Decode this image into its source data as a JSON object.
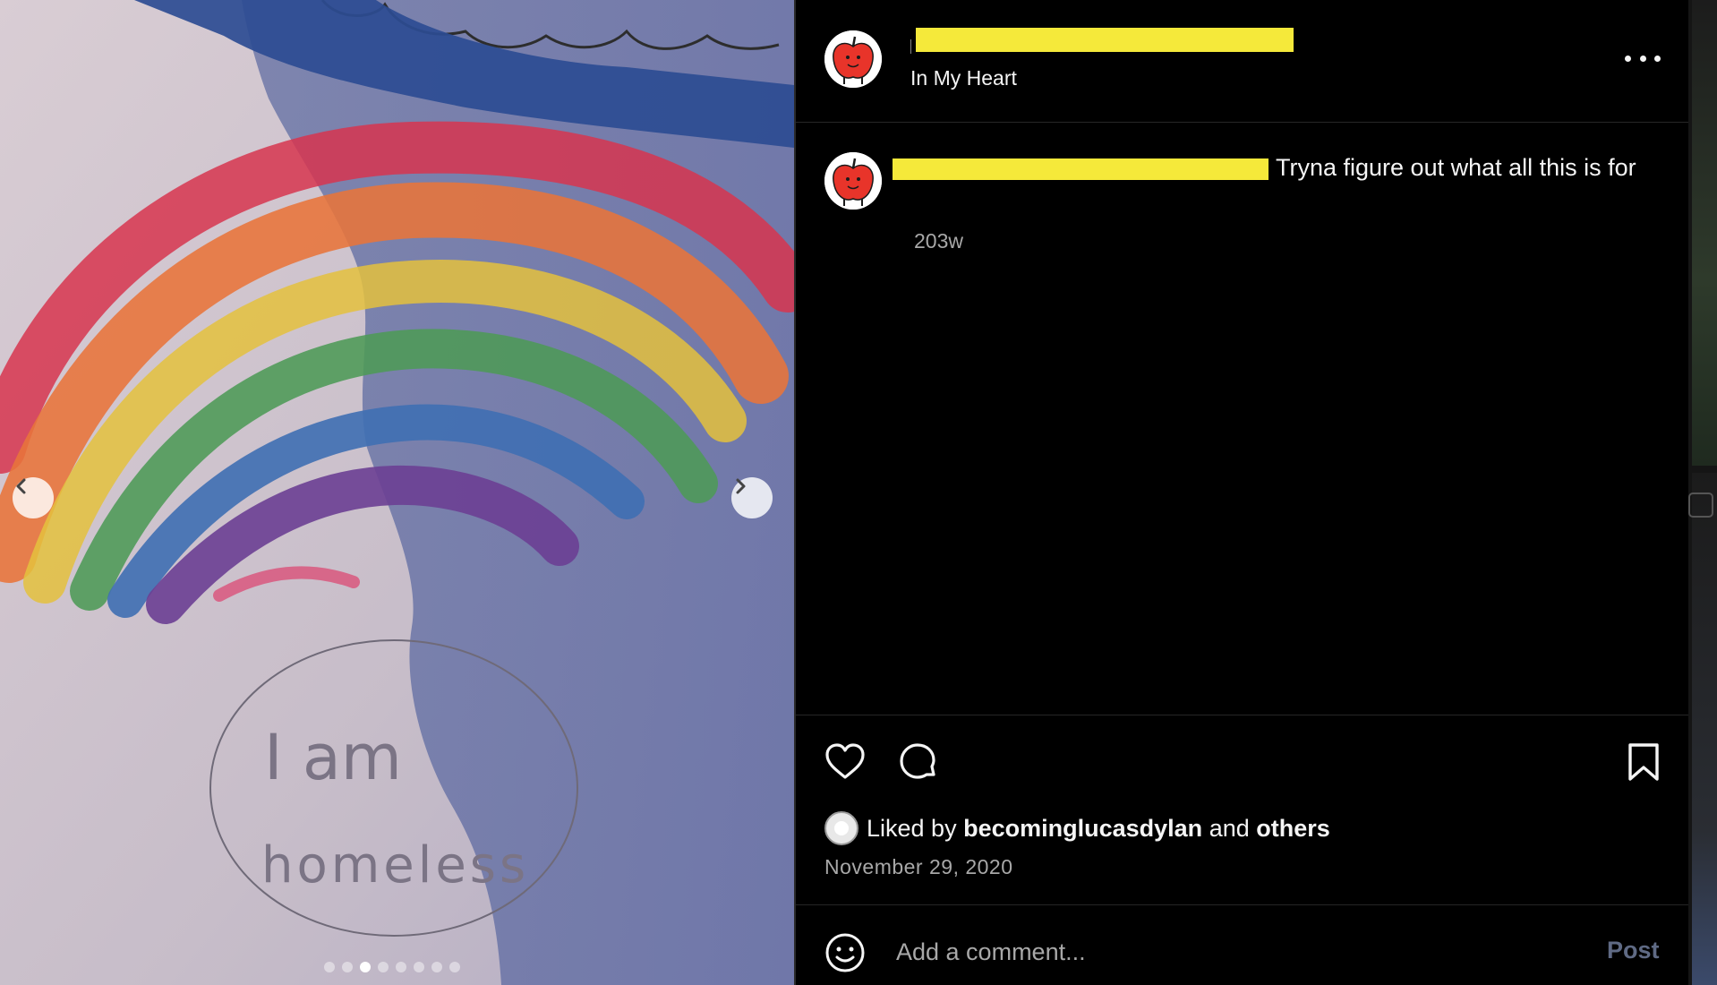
{
  "post": {
    "location": "In My Heart",
    "caption": "Tryna figure out what all this is for",
    "time_ago": "203w",
    "date": "November 29, 2020"
  },
  "likes": {
    "prefix": "Liked by",
    "user": "becominglucasdylan",
    "joiner": "and",
    "others": "others"
  },
  "comment_box": {
    "placeholder": "Add a comment...",
    "post_label": "Post"
  },
  "carousel": {
    "total": 8,
    "active_index": 3
  },
  "drawing_text": {
    "line1": "I am",
    "line2": "homeless"
  },
  "icons": [
    "chevron-left-icon",
    "chevron-right-icon",
    "more-icon",
    "heart-icon",
    "comment-icon",
    "bookmark-icon",
    "emoji-icon"
  ],
  "colors": {
    "background": "#000000",
    "redaction": "#f5e93a",
    "muted_text": "#a8a8a8",
    "post_button": "#5f6a84"
  }
}
